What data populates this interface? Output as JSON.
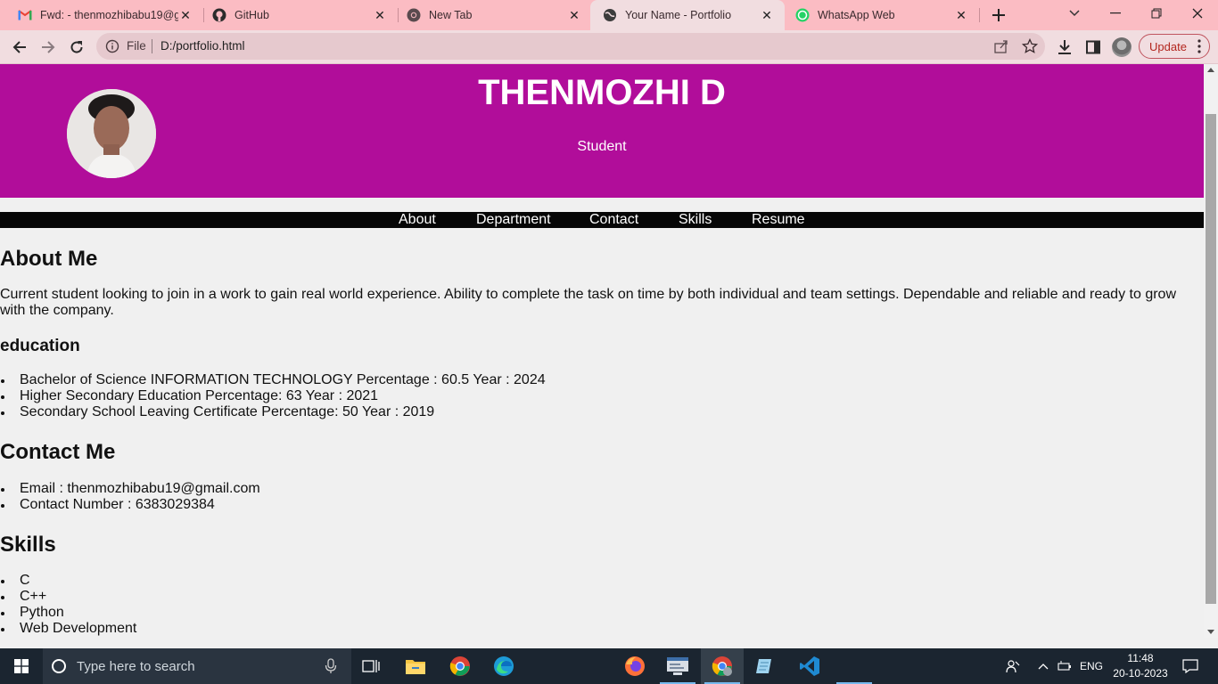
{
  "browser": {
    "tabs": [
      {
        "title": "Fwd: - thenmozhibabu19@g",
        "icon": "gmail-icon"
      },
      {
        "title": "GitHub",
        "icon": "github-icon"
      },
      {
        "title": "New Tab",
        "icon": "chrome-icon"
      },
      {
        "title": "Your Name - Portfolio",
        "icon": "globe-icon",
        "active": true
      },
      {
        "title": "WhatsApp Web",
        "icon": "whatsapp-icon"
      }
    ],
    "address": {
      "scheme": "File",
      "url": "D:/portfolio.html"
    },
    "update_label": "Update"
  },
  "page": {
    "name": "THENMOZHI D",
    "role": "Student",
    "nav": [
      "About",
      "Department",
      "Contact",
      "Skills",
      "Resume"
    ],
    "about_heading": "About Me",
    "about_text": "Current student looking to join in a work to gain real world experience. Ability to complete the task on time by both individual and team settings. Dependable and reliable and ready to grow with the company.",
    "education_heading": "education",
    "education": [
      "Bachelor of Science INFORMATION TECHNOLOGY Percentage : 60.5 Year : 2024",
      "Higher Secondary Education Percentage: 63 Year : 2021",
      "Secondary School Leaving Certificate Percentage: 50 Year : 2019"
    ],
    "contact_heading": "Contact Me",
    "contact": [
      "Email : thenmozhibabu19@gmail.com",
      "Contact Number : 6383029384"
    ],
    "skills_heading": "Skills",
    "skills": [
      "C",
      "C++",
      "Python",
      "Web Development"
    ]
  },
  "taskbar": {
    "search_placeholder": "Type here to search",
    "language": "ENG",
    "time": "11:48",
    "date": "20-10-2023"
  },
  "colors": {
    "tab_strip": "#fbbcc3",
    "toolbar": "#f1dde0",
    "hero": "#b10d9a",
    "nav": "#060606",
    "taskbar": "#1b2530"
  }
}
